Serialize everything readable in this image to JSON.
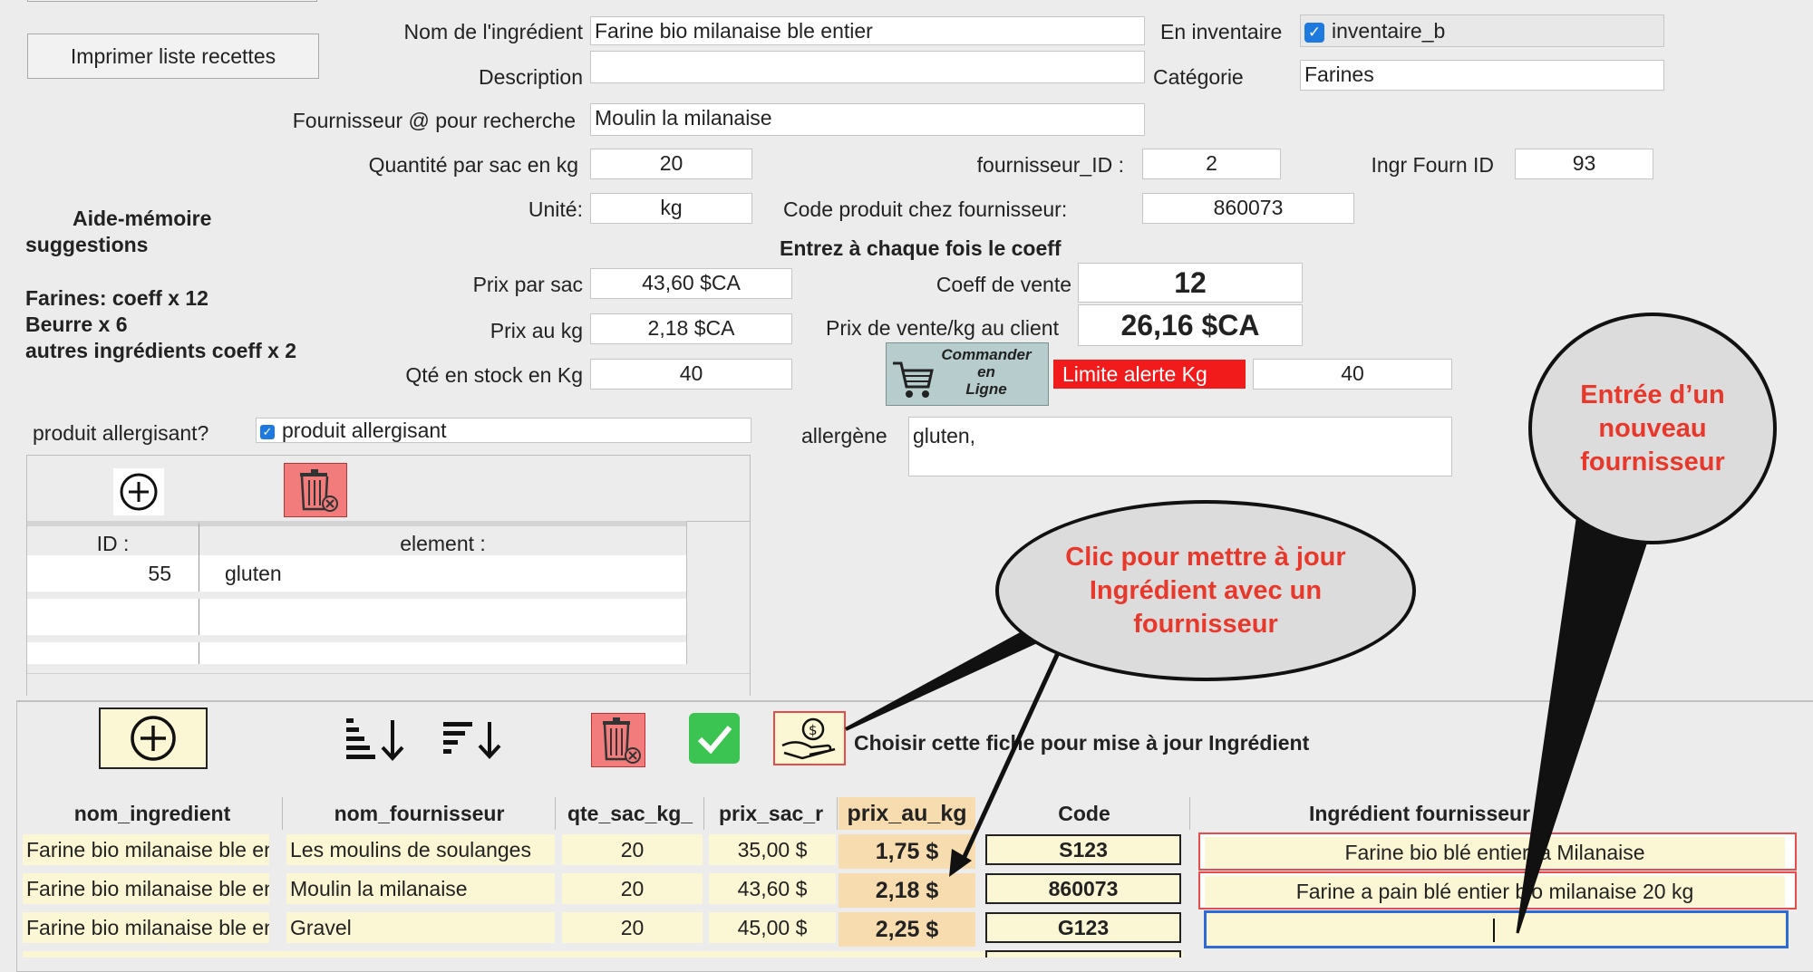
{
  "buttons": {
    "print_recipes": "Imprimer liste recettes",
    "order_online": [
      "Commander",
      "en",
      "Ligne"
    ]
  },
  "form": {
    "ingredient_name_label": "Nom de l'ingrédient",
    "ingredient_name": "Farine bio milanaise ble entier",
    "in_inventory_label": "En inventaire",
    "in_inventory_checkbox": "inventaire_b",
    "description_label": "Description",
    "description": "",
    "category_label": "Catégorie",
    "category": "Farines",
    "supplier_search_label": "Fournisseur @ pour recherche",
    "supplier_search": "Moulin la milanaise",
    "qty_per_bag_label": "Quantité par sac en kg",
    "qty_per_bag": "20",
    "supplier_id_label": "fournisseur_ID :",
    "supplier_id": "2",
    "ingr_fourn_id_label": "Ingr Fourn ID",
    "ingr_fourn_id": "93",
    "unit_label": "Unité:",
    "unit": "kg",
    "product_code_label": "Code produit chez fournisseur:",
    "product_code": "860073",
    "coeff_note": "Entrez à chaque fois le coeff",
    "price_per_bag_label": "Prix par sac",
    "price_per_bag": "43,60 $CA",
    "sale_coeff_label": "Coeff de vente",
    "sale_coeff": "12",
    "price_per_kg_label": "Prix au kg",
    "price_per_kg": "2,18 $CA",
    "sale_price_label": "Prix de vente/kg au client",
    "sale_price": "26,16 $CA",
    "stock_label": "Qté en stock en Kg",
    "stock": "40",
    "alert_limit_label": "Limite alerte Kg",
    "alert_limit": "40",
    "allergen_q_label": "produit allergisant?",
    "allergen_checkbox": "produit allergisant",
    "allergen_label": "allergène",
    "allergen": "gluten,"
  },
  "memo": {
    "title": "Aide-mémoire",
    "subtitle": "suggestions",
    "line1": "Farines: coeff x 12",
    "line2": "Beurre x 6",
    "line3": "autres ingrédients coeff x 2"
  },
  "allergen_table": {
    "headers": [
      "ID :",
      "element :"
    ],
    "rows": [
      {
        "id": "55",
        "element": "gluten"
      }
    ]
  },
  "supplier_toolbar": {
    "choose_label": "Choisir cette fiche pour mise à jour Ingrédient"
  },
  "supplier_table": {
    "headers": [
      "nom_ingredient",
      "nom_fournisseur",
      "qte_sac_kg_",
      "prix_sac_r",
      "prix_au_kg",
      "Code",
      "Ingrédient fournisseur"
    ],
    "rows": [
      {
        "ingredient": "Farine bio milanaise ble entier",
        "supplier": "Les moulins de soulanges",
        "qty": "20",
        "bag_price": "35,00 $",
        "kg_price": "1,75 $",
        "code": "S123",
        "supplier_ingredient": "Farine bio blé entier la Milanaise"
      },
      {
        "ingredient": "Farine bio milanaise ble entier",
        "supplier": "Moulin la milanaise",
        "qty": "20",
        "bag_price": "43,60 $",
        "kg_price": "2,18 $",
        "code": "860073",
        "supplier_ingredient": "Farine a pain blé entier bio milanaise 20 kg"
      },
      {
        "ingredient": "Farine bio milanaise ble entier",
        "supplier": "Gravel",
        "qty": "20",
        "bag_price": "45,00 $",
        "kg_price": "2,25 $",
        "code": "G123",
        "supplier_ingredient": ""
      }
    ]
  },
  "callouts": {
    "update": [
      "Clic pour mettre à jour",
      "Ingrédient avec un",
      "fournisseur"
    ],
    "new_supplier": [
      "Entrée d’un",
      "nouveau",
      "fournisseur"
    ]
  },
  "colors": {
    "alert_red": "#f21b1b",
    "callout_text": "#e8382c",
    "highlight_yellow": "#fbf6d3",
    "kg_peach": "#f6dcae"
  }
}
